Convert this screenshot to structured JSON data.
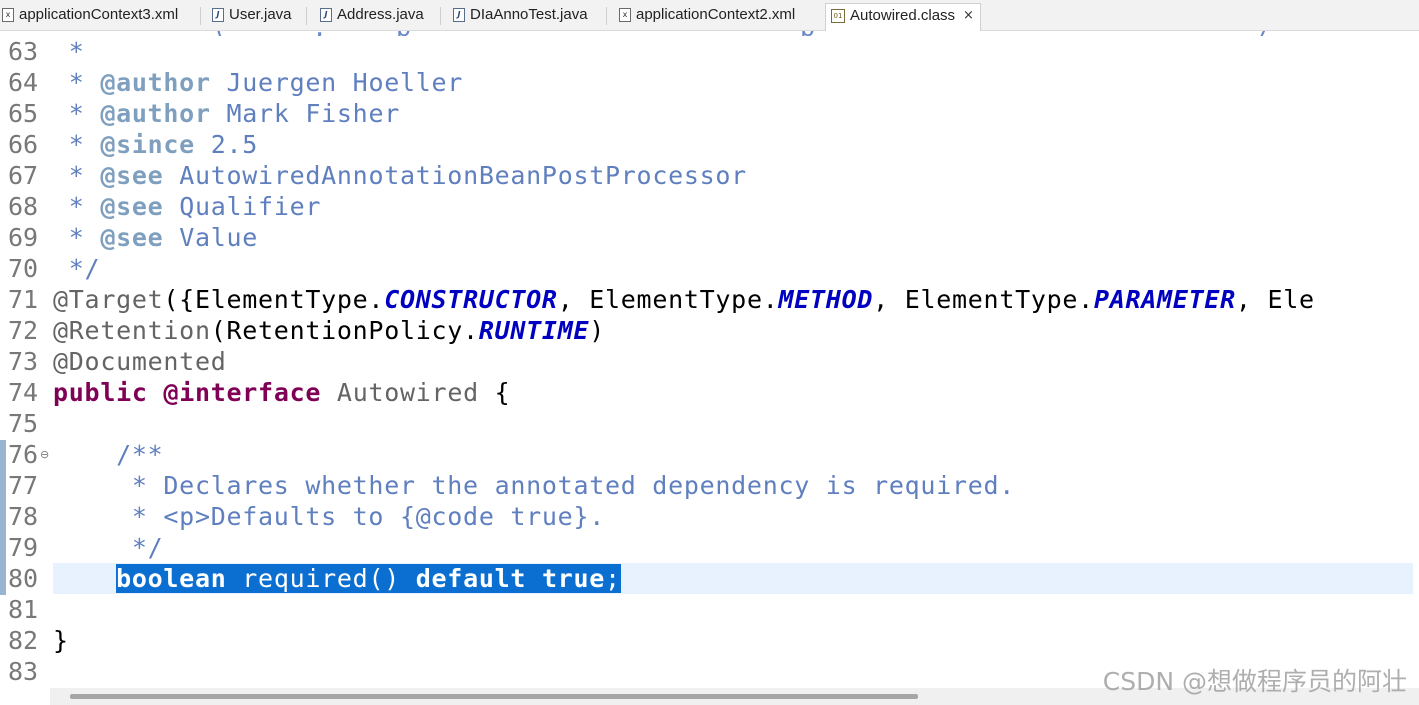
{
  "tabs": [
    {
      "label": "applicationContext3.xml",
      "icon": "xml-file-icon",
      "active": false
    },
    {
      "label": "User.java",
      "icon": "java-file-icon",
      "active": false
    },
    {
      "label": "Address.java",
      "icon": "java-file-icon",
      "active": false
    },
    {
      "label": "DIaAnnoTest.java",
      "icon": "java-file-icon",
      "active": false
    },
    {
      "label": "applicationContext2.xml",
      "icon": "xml-file-icon",
      "active": false
    },
    {
      "label": "Autowired.class",
      "icon": "class-file-icon",
      "active": true,
      "close": "×"
    }
  ],
  "editor": {
    "lines": [
      {
        "num": "63",
        "segments": [
          {
            "c": "cm",
            "t": " *"
          }
        ]
      },
      {
        "num": "64",
        "segments": [
          {
            "c": "cm",
            "t": " * "
          },
          {
            "c": "tag",
            "t": "@author"
          },
          {
            "c": "cm",
            "t": " Juergen Hoeller"
          }
        ]
      },
      {
        "num": "65",
        "segments": [
          {
            "c": "cm",
            "t": " * "
          },
          {
            "c": "tag",
            "t": "@author"
          },
          {
            "c": "cm",
            "t": " Mark Fisher"
          }
        ]
      },
      {
        "num": "66",
        "segments": [
          {
            "c": "cm",
            "t": " * "
          },
          {
            "c": "tag",
            "t": "@since"
          },
          {
            "c": "cm",
            "t": " 2.5"
          }
        ]
      },
      {
        "num": "67",
        "segments": [
          {
            "c": "cm",
            "t": " * "
          },
          {
            "c": "tag",
            "t": "@see"
          },
          {
            "c": "cm",
            "t": " AutowiredAnnotationBeanPostProcessor"
          }
        ]
      },
      {
        "num": "68",
        "segments": [
          {
            "c": "cm",
            "t": " * "
          },
          {
            "c": "tag",
            "t": "@see"
          },
          {
            "c": "cm",
            "t": " Qualifier"
          }
        ]
      },
      {
        "num": "69",
        "segments": [
          {
            "c": "cm",
            "t": " * "
          },
          {
            "c": "tag",
            "t": "@see"
          },
          {
            "c": "cm",
            "t": " Value"
          }
        ]
      },
      {
        "num": "70",
        "segments": [
          {
            "c": "cm",
            "t": " */"
          }
        ]
      },
      {
        "num": "71",
        "segments": [
          {
            "c": "an",
            "t": "@Target"
          },
          {
            "c": "tx",
            "t": "({ElementType."
          },
          {
            "c": "cn",
            "t": "CONSTRUCTOR"
          },
          {
            "c": "tx",
            "t": ", ElementType."
          },
          {
            "c": "cn",
            "t": "METHOD"
          },
          {
            "c": "tx",
            "t": ", ElementType."
          },
          {
            "c": "cn",
            "t": "PARAMETER"
          },
          {
            "c": "tx",
            "t": ", Ele"
          }
        ]
      },
      {
        "num": "72",
        "segments": [
          {
            "c": "an",
            "t": "@Retention"
          },
          {
            "c": "tx",
            "t": "(RetentionPolicy."
          },
          {
            "c": "cn",
            "t": "RUNTIME"
          },
          {
            "c": "tx",
            "t": ")"
          }
        ]
      },
      {
        "num": "73",
        "segments": [
          {
            "c": "an",
            "t": "@Documented"
          }
        ]
      },
      {
        "num": "74",
        "segments": [
          {
            "c": "kw",
            "t": "public"
          },
          {
            "c": "tx",
            "t": " "
          },
          {
            "c": "kw",
            "t": "@interface"
          },
          {
            "c": "tx",
            "t": " "
          },
          {
            "c": "gr",
            "t": "Autowired"
          },
          {
            "c": "tx",
            "t": " {"
          }
        ]
      },
      {
        "num": "75",
        "segments": []
      },
      {
        "num": "76",
        "fold": "⊖",
        "segments": [
          {
            "c": "cm",
            "t": "    /**"
          }
        ]
      },
      {
        "num": "77",
        "segments": [
          {
            "c": "cm",
            "t": "     * Declares whether the annotated dependency is required."
          }
        ]
      },
      {
        "num": "78",
        "segments": [
          {
            "c": "cm",
            "t": "     * <p>Defaults to {@code true}."
          }
        ]
      },
      {
        "num": "79",
        "segments": [
          {
            "c": "cm",
            "t": "     */"
          }
        ]
      },
      {
        "num": "80",
        "current": true,
        "segments": [
          {
            "c": "tx",
            "t": "    "
          },
          {
            "c": "sel kw",
            "t": "boolean"
          },
          {
            "c": "sel gr",
            "t": " required() "
          },
          {
            "c": "sel kw",
            "t": "default"
          },
          {
            "c": "sel tx",
            "t": " "
          },
          {
            "c": "sel kw",
            "t": "true"
          },
          {
            "c": "sel tx",
            "t": ";"
          }
        ]
      },
      {
        "num": "81",
        "segments": []
      },
      {
        "num": "82",
        "segments": [
          {
            "c": "tx",
            "t": "}"
          }
        ]
      },
      {
        "num": "83",
        "segments": []
      }
    ]
  },
  "watermark": "CSDN @想做程序员的阿壮"
}
